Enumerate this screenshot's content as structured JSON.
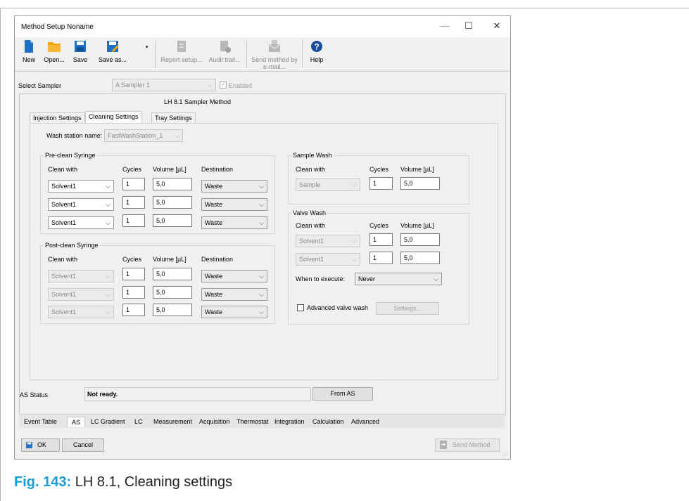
{
  "window": {
    "title": "Method Setup Noname",
    "minimize_glyph": "—",
    "maximize_glyph": "☐",
    "close_glyph": "✕"
  },
  "toolbar": {
    "new": "New",
    "open": "Open...",
    "save": "Save",
    "save_as": "Save as...",
    "report_setup": "Report setup...",
    "audit_trail": "Audit trail...",
    "send_method_line1": "Send method by",
    "send_method_line2": "e-mail...",
    "help": "Help"
  },
  "sampler": {
    "label": "Select Sampler",
    "value": "A Sampler 1",
    "enabled_label": "Enabled"
  },
  "method_title": "LH 8.1 Sampler Method",
  "tabs": [
    "Injection Settings",
    "Cleaning Settings",
    "Tray Settings"
  ],
  "wash_station": {
    "label": "Wash station name:",
    "value": "FastWashStation_1"
  },
  "pre_clean": {
    "title": "Pre-clean Syringe",
    "headers": {
      "clean_with": "Clean with",
      "cycles": "Cycles",
      "volume": "Volume [µL]",
      "destination": "Destination"
    },
    "rows": [
      {
        "solvent": "Solvent1",
        "cycles": "1",
        "volume": "5,0",
        "destination": "Waste"
      },
      {
        "solvent": "Solvent1",
        "cycles": "1",
        "volume": "5,0",
        "destination": "Waste"
      },
      {
        "solvent": "Solvent1",
        "cycles": "1",
        "volume": "5,0",
        "destination": "Waste"
      }
    ]
  },
  "post_clean": {
    "title": "Post-clean Syringe",
    "headers": {
      "clean_with": "Clean with",
      "cycles": "Cycles",
      "volume": "Volume [µL]",
      "destination": "Destination"
    },
    "rows": [
      {
        "solvent": "Solvent1",
        "cycles": "1",
        "volume": "5,0",
        "destination": "Waste"
      },
      {
        "solvent": "Solvent1",
        "cycles": "1",
        "volume": "5,0",
        "destination": "Waste"
      },
      {
        "solvent": "Solvent1",
        "cycles": "1",
        "volume": "5,0",
        "destination": "Waste"
      }
    ]
  },
  "sample_wash": {
    "title": "Sample Wash",
    "headers": {
      "clean_with": "Clean with",
      "cycles": "Cycles",
      "volume": "Volume [µL]"
    },
    "row": {
      "solvent": "Sample",
      "cycles": "1",
      "volume": "5,0"
    }
  },
  "valve_wash": {
    "title": "Valve Wash",
    "headers": {
      "clean_with": "Clean with",
      "cycles": "Cycles",
      "volume": "Volume [µL]"
    },
    "rows": [
      {
        "solvent": "Solvent1",
        "cycles": "1",
        "volume": "5,0"
      },
      {
        "solvent": "Solvent1",
        "cycles": "1",
        "volume": "5,0"
      }
    ],
    "when_label": "When to execute:",
    "when_value": "Never",
    "advanced_label": "Advanced valve wash",
    "settings_button": "Settings..."
  },
  "status": {
    "label": "AS Status",
    "value": "Not ready.",
    "from_as_button": "From AS"
  },
  "bottom_tabs": [
    "Event Table",
    "AS",
    "LC Gradient",
    "LC",
    "Measurement",
    "Acquisition",
    "Thermostat",
    "Integration",
    "Calculation",
    "Advanced"
  ],
  "footer": {
    "ok": "OK",
    "cancel": "Cancel",
    "send_method": "Send Method"
  },
  "caption": {
    "number": "Fig. 143:",
    "text": "LH 8.1, Cleaning settings"
  },
  "colors": {
    "caption_accent": "#1a9bd7",
    "icon_blue": "#1d6fc4",
    "icon_folder": "#f0a400",
    "help_blue": "#1a4e9c"
  }
}
